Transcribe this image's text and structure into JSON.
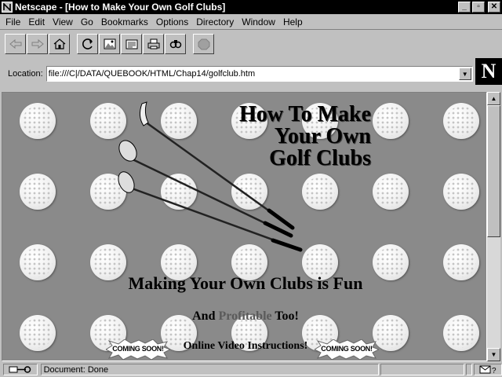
{
  "window": {
    "title": "Netscape - [How to Make Your Own Golf Clubs]",
    "minimize": "_",
    "maximize": "▫",
    "close": "✕"
  },
  "menu": [
    "File",
    "Edit",
    "View",
    "Go",
    "Bookmarks",
    "Options",
    "Directory",
    "Window",
    "Help"
  ],
  "toolbar": {
    "buttons": [
      "back-icon",
      "forward-icon",
      "home-icon",
      "reload-icon",
      "images-icon",
      "open-icon",
      "print-icon",
      "find-icon",
      "stop-icon"
    ]
  },
  "location": {
    "label": "Location:",
    "url": "file:///C|/DATA/QUEBOOK/HTML/Chap14/golfclub.htm"
  },
  "logo": "N",
  "page": {
    "title_lines": [
      "How To Make",
      "Your Own",
      "Golf Clubs"
    ],
    "subtitle": "Making Your Own Clubs is Fun",
    "line2_prefix": "And ",
    "line2_accent": "Profitable",
    "line2_suffix": " Too!",
    "line3": "Online Video Instructions!",
    "badge_left": "COMING SOON!",
    "badge_right": "COMING SOON!"
  },
  "status": {
    "text": "Document: Done"
  },
  "colors": {
    "content_bg": "#8a8a8a",
    "accent_text": "#5a5a5a"
  }
}
